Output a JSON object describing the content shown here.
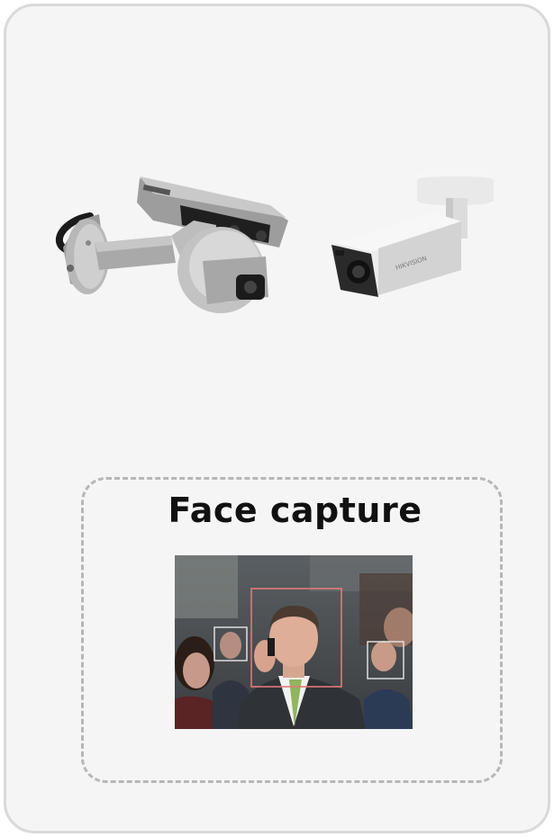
{
  "products": {
    "camera_1": {
      "icon": "dome-panoramic-camera-icon",
      "brand": "HIKVISION"
    },
    "camera_2": {
      "icon": "bullet-camera-icon",
      "brand": "HIKVISION"
    }
  },
  "face_capture": {
    "title": "Face capture",
    "photo_icon": "crowd-face-detection-photo",
    "detection_box_colors": {
      "primary": "#e07a7a",
      "secondary": "#e8e8e8"
    }
  },
  "colors": {
    "card_bg": "#f5f5f5",
    "card_border": "#d9d9d9",
    "dash_border": "#b7b7b7"
  }
}
